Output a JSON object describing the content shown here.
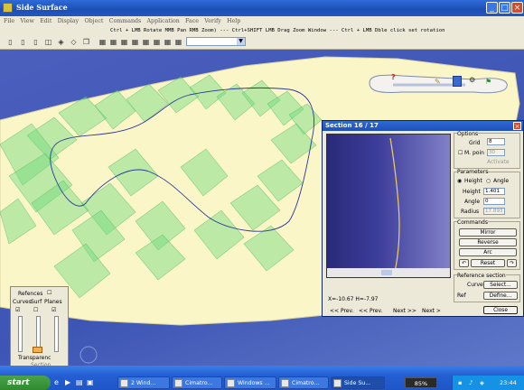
{
  "window": {
    "title": "Side Surface",
    "minimize_glyph": "_",
    "maximize_glyph": "□",
    "close_glyph": "×"
  },
  "menu": [
    "File",
    "View",
    "Edit",
    "Display",
    "Object",
    "Commands",
    "Application",
    "Face",
    "Verify",
    "Help"
  ],
  "status_hint": "Ctrl + LMB Rotate MMB Pan RMB Zoom) --- Ctrl+SHIFT LMB Drag  Zoom Window  --- Ctrl + LMB Dble click set rotation",
  "toolbar": {
    "icons": [
      "view-icon",
      "view-icon",
      "view-icon",
      "view-icon",
      "shade-icon",
      "shade-icon",
      "shade-icon",
      "shade-icon",
      "render-icon",
      "grid-icon",
      "grid-icon",
      "grid-icon",
      "grid-icon",
      "grid-icon",
      "grid-icon",
      "grid-icon",
      "grid-icon"
    ],
    "view_select_value": ""
  },
  "section_dialog": {
    "title": "Section 16 / 17",
    "readout": "X=-10.67 H=-7.97",
    "options_label": "Options",
    "grid_label": "Grid",
    "grid_value": "8",
    "m_point_label": "M. poin",
    "m_point_value": "30",
    "activate_label": "Activate",
    "parameters_label": "Parameters",
    "height_radio": "Height",
    "angle_radio": "Angle",
    "height_label": "Height",
    "height_value": "1.401",
    "angle_label": "Angle",
    "angle_value": "0",
    "radius_label": "Radius",
    "radius_value": "17.893",
    "commands_label": "Commands",
    "mirror_btn": "Mirror",
    "reverse_btn": "Reverse",
    "arc_btn": "Arc",
    "reset_btn": "Reset",
    "refsection_label": "Reference section",
    "curve_label": "Curve",
    "select_btn": "Select...",
    "ref_label": "Ref",
    "define_btn": "Define...",
    "prev1": "<< Prev.",
    "prev2": "<< Prev.",
    "next1": "Next >>",
    "next2": "Next >",
    "close_btn": "Close"
  },
  "transparency_panel": {
    "references_label": "Refences",
    "curves_label": "Curves",
    "surf_label": "Surf",
    "planes_label": "Planes",
    "transparency_label": "Transparenc",
    "section_label": "Section"
  },
  "taskbar": {
    "start_label": "start",
    "tasks": [
      "2 Wind...",
      "Cimatro...",
      "Windows ...",
      "Cimatro...",
      "Side Su..."
    ],
    "battery": "85%",
    "clock": "23:44"
  },
  "colors": {
    "viewport_bg": "#4b5fbd",
    "surface": "#fbf6c7",
    "patches": "#7fe08a",
    "curve": "#2a3a9c",
    "title_bar": "#2456c0"
  }
}
